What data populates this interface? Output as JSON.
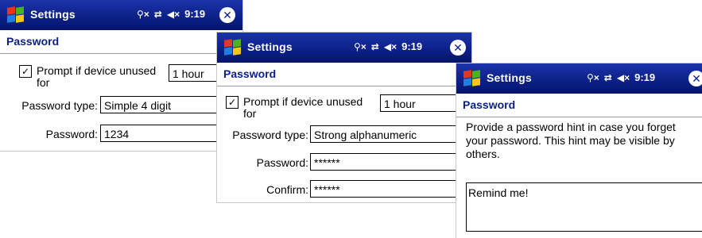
{
  "colors": {
    "titlebar": "#0b1f86",
    "page_title": "#0b1f86",
    "background": "#ffffff"
  },
  "windows": [
    {
      "app_title": "Settings",
      "status_icons": [
        "connectivity-icon",
        "sync-icon",
        "speaker-muted-icon"
      ],
      "time": "9:19",
      "close_symbol": "✕",
      "page_title": "Password",
      "prompt_label_line1": "Prompt if device unused",
      "prompt_label_line2": "for",
      "prompt_checked": true,
      "check_mark": "✓",
      "timeout_value": "1 hour",
      "password_type_label": "Password type:",
      "password_type_value": "Simple 4 digit",
      "password_label": "Password:",
      "password_value": "1234"
    },
    {
      "app_title": "Settings",
      "status_icons": [
        "connectivity-icon",
        "sync-icon",
        "speaker-muted-icon"
      ],
      "time": "9:19",
      "close_symbol": "✕",
      "page_title": "Password",
      "prompt_label_line1": "Prompt if device unused",
      "prompt_label_line2": "for",
      "prompt_checked": true,
      "check_mark": "✓",
      "timeout_value": "1 hour",
      "password_type_label": "Password type:",
      "password_type_value": "Strong alphanumeric",
      "password_label": "Password:",
      "password_value": "******",
      "confirm_label": "Confirm:",
      "confirm_value": "******"
    },
    {
      "app_title": "Settings",
      "status_icons": [
        "connectivity-icon",
        "sync-icon",
        "speaker-muted-icon"
      ],
      "time": "9:19",
      "close_symbol": "✕",
      "page_title": "Password",
      "hint_description": "Provide a password hint in case you forget your password. This hint may be visible by others.",
      "hint_value": "Remind me!"
    }
  ]
}
